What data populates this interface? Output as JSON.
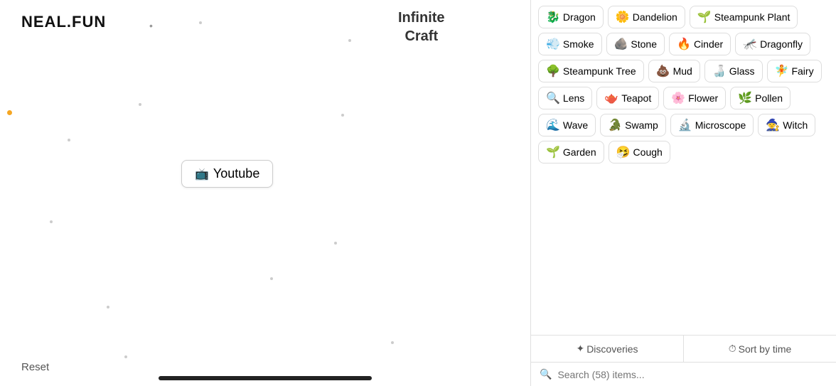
{
  "logo": "NEAL.FUN",
  "title_line1": "Infinite",
  "title_line2": "Craft",
  "youtube_card": {
    "emoji": "📺",
    "label": "Youtube"
  },
  "reset_button": "Reset",
  "items": [
    {
      "emoji": "🐉",
      "label": "Dragon"
    },
    {
      "emoji": "🌼",
      "label": "Dandelion"
    },
    {
      "emoji": "🌱",
      "label": "Steampunk Plant"
    },
    {
      "emoji": "💨",
      "label": "Smoke"
    },
    {
      "emoji": "🪨",
      "label": "Stone"
    },
    {
      "emoji": "🔥",
      "label": "Cinder"
    },
    {
      "emoji": "🦟",
      "label": "Dragonfly"
    },
    {
      "emoji": "🌳",
      "label": "Steampunk Tree"
    },
    {
      "emoji": "💩",
      "label": "Mud"
    },
    {
      "emoji": "🍶",
      "label": "Glass"
    },
    {
      "emoji": "🧚",
      "label": "Fairy"
    },
    {
      "emoji": "🔍",
      "label": "Lens"
    },
    {
      "emoji": "🫖",
      "label": "Teapot"
    },
    {
      "emoji": "🌸",
      "label": "Flower"
    },
    {
      "emoji": "🌿",
      "label": "Pollen"
    },
    {
      "emoji": "🌊",
      "label": "Wave"
    },
    {
      "emoji": "🐊",
      "label": "Swamp"
    },
    {
      "emoji": "🔬",
      "label": "Microscope"
    },
    {
      "emoji": "🧙",
      "label": "Witch"
    },
    {
      "emoji": "🌱",
      "label": "Garden"
    },
    {
      "emoji": "🤧",
      "label": "Cough"
    }
  ],
  "footer": {
    "discoveries_label": "✦ Discoveries",
    "sort_label": "⏱ Sort by time",
    "search_placeholder": "Search (58) items..."
  }
}
